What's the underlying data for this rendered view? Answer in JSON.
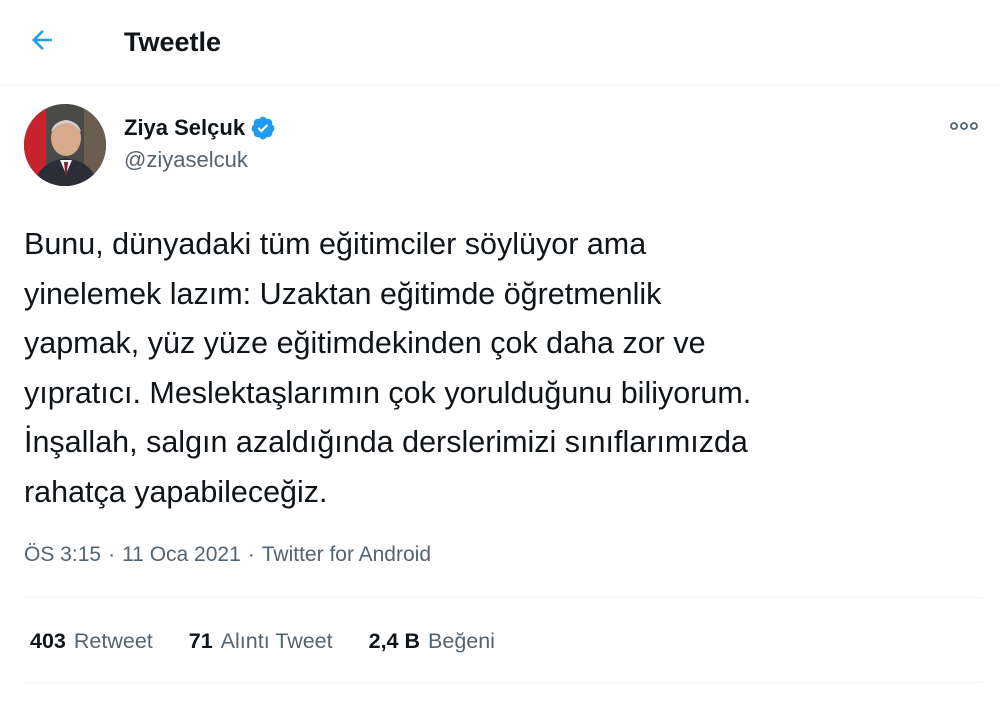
{
  "header": {
    "title": "Tweetle",
    "back_icon": "arrow-left-icon",
    "accent_color": "#1d9bf0"
  },
  "author": {
    "name": "Ziya Selçuk",
    "handle": "@ziyaselcuk",
    "verified": true,
    "verified_color": "#1d9bf0"
  },
  "tweet": {
    "text": "Bunu, dünyadaki tüm eğitimciler söylüyor ama\nyinelemek lazım: Uzaktan eğitimde öğretmenlik\nyapmak, yüz yüze eğitimdekinden çok daha zor ve\nyıpratıcı. Meslektaşlarımın çok yorulduğunu biliyorum.\nİnşallah, salgın azaldığında derslerimizi sınıflarımızda\nrahatça yapabileceğiz.",
    "time": "ÖS 3:15",
    "date": "11 Oca 2021",
    "source": "Twitter for Android",
    "separator": "·"
  },
  "stats": {
    "retweets": {
      "count": "403",
      "label": "Retweet"
    },
    "quotes": {
      "count": "71",
      "label": "Alıntı Tweet"
    },
    "likes": {
      "count": "2,4 B",
      "label": "Beğeni"
    }
  }
}
